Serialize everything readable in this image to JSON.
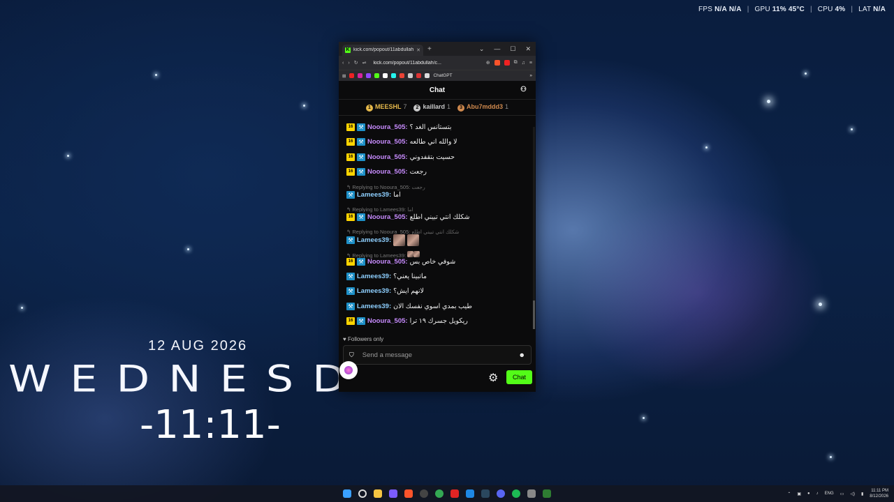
{
  "hud": {
    "fps_label": "FPS",
    "fps_value": "N/A",
    "fps_value2": "N/A",
    "gpu_label": "GPU",
    "gpu_value": "11% 45°C",
    "cpu_label": "CPU",
    "cpu_value": "4%",
    "lat_label": "LAT",
    "lat_value": "N/A"
  },
  "widget": {
    "date": "12 AUG 2026",
    "weekday": "WEDNESDAY",
    "time": "-11:11-"
  },
  "browser": {
    "tab_title": "kick.com/popout/11abdullah/c...",
    "new_tab": "+",
    "url": "kick.com/popout/11abdullah/c...",
    "bookmark_label": "ChatGPT"
  },
  "chat": {
    "title": "Chat",
    "leaderboard": [
      {
        "rank": "1",
        "name": "MEESHL",
        "count": "7",
        "color": "#e6b94b"
      },
      {
        "rank": "2",
        "name": "kaillard",
        "count": "1",
        "color": "#c9c9c9"
      },
      {
        "rank": "3",
        "name": "Abu7mddd3",
        "count": "1",
        "color": "#d08a4e"
      }
    ],
    "badge16": "16",
    "messages": [
      {
        "user": "Nooura_505:",
        "text": "بتستانس الغد ؟"
      },
      {
        "user": "Nooura_505:",
        "text": "لا والله اني طالعه"
      },
      {
        "user": "Nooura_505:",
        "text": "حسيت بتقفدوني"
      },
      {
        "user": "Nooura_505:",
        "text": "رجعت"
      },
      {
        "reply": "Replying to Noou​ra_505:",
        "reply_text": "رجعت"
      },
      {
        "user": "Lamees39:",
        "text": "اما"
      },
      {
        "reply": "Replying to Lamees39:",
        "reply_text": "اما"
      },
      {
        "user": "Nooura_505:",
        "text": "شكلك انتي تبيني اطلع"
      },
      {
        "reply": "Replying to Nooura_505:",
        "reply_text": "شكلك انتي تبيني اطلع"
      },
      {
        "user": "Lamees39:",
        "text": ""
      },
      {
        "reply": "Replying to Lamees39:",
        "reply_text": ""
      },
      {
        "user": "Nooura_505:",
        "text": "شوفي خاص بس"
      },
      {
        "user": "Lamees39:",
        "text": "ماتبينا يعني؟"
      },
      {
        "user": "Lamees39:",
        "text": "لانهم ايش؟"
      },
      {
        "user": "Lamees39:",
        "text": "طيب بمدي اسوي نفسك الان"
      },
      {
        "user": "Nooura_505:",
        "text": "ريكويل جسرك ١٩ ترا"
      }
    ],
    "followers_only": "Followers only",
    "input_placeholder": "Send a message",
    "send_label": "Chat"
  },
  "taskbar": {
    "lang": "ENG",
    "time": "11:11 PM",
    "date": "8/12/2026"
  },
  "colors": {
    "kick_green": "#53fc18",
    "bg": "#0b0b0c"
  }
}
